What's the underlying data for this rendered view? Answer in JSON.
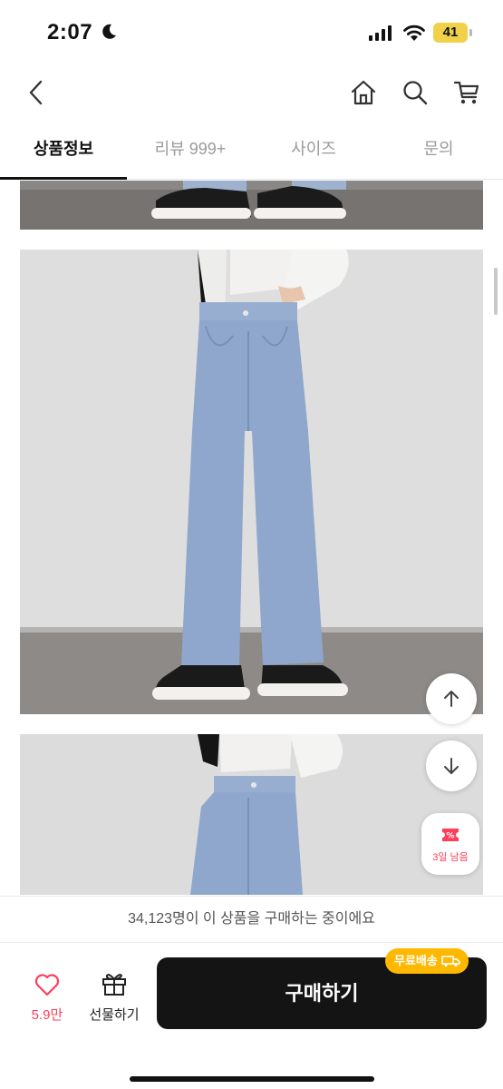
{
  "status_bar": {
    "time": "2:07",
    "battery": "41"
  },
  "navbar": {
    "icons": [
      "back-icon",
      "home-icon",
      "search-icon",
      "cart-icon"
    ]
  },
  "tabs": [
    {
      "label": "상품정보",
      "active": true
    },
    {
      "label": "리뷰 999+",
      "active": false
    },
    {
      "label": "사이즈",
      "active": false
    },
    {
      "label": "문의",
      "active": false
    }
  ],
  "floating": {
    "scroll_up": "arrow-up-icon",
    "scroll_down": "arrow-down-icon",
    "coupon_label": "3일 남음",
    "coupon_badge": "%"
  },
  "purchase_notice": "34,123명이 이 상품을 구매하는 중이에요",
  "bottom_bar": {
    "like_count": "5.9만",
    "gift_label": "선물하기",
    "buy_label": "구매하기",
    "free_shipping": "무료배송"
  },
  "colors": {
    "accent_pink": "#ff3d5a",
    "free_shipping_badge": "#ffb800",
    "buy_button": "#141414"
  }
}
